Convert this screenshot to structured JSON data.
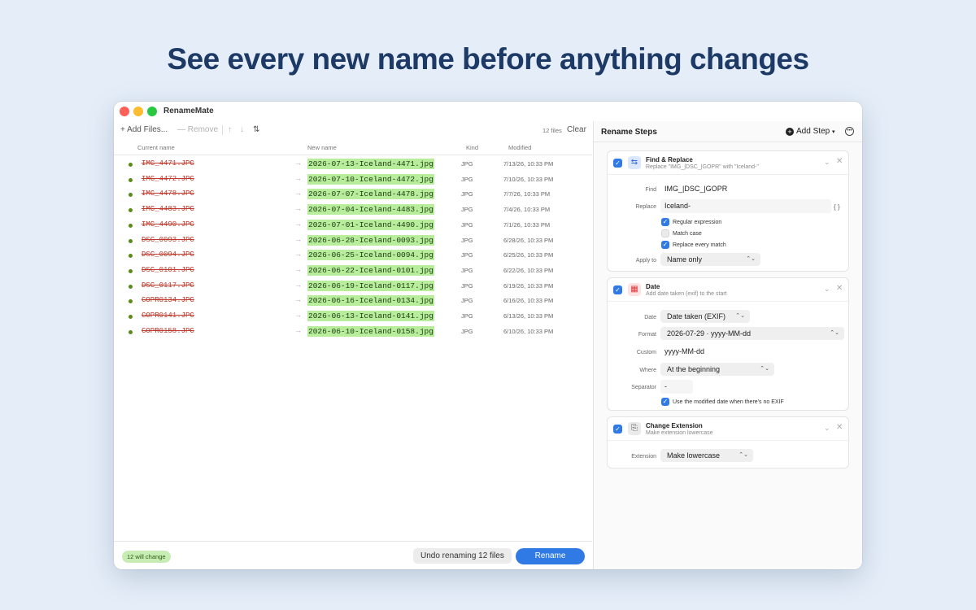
{
  "headline": "See every new name before anything changes",
  "window": {
    "title": "RenameMate"
  },
  "toolbar": {
    "add_files": "Add Files...",
    "remove": "Remove",
    "file_count": "12 files",
    "clear": "Clear"
  },
  "columns": {
    "current": "Current name",
    "new": "New name",
    "kind": "Kind",
    "modified": "Modified"
  },
  "files": [
    {
      "current": "IMG_4471.JPG",
      "new": "2026-07-13-Iceland-4471.jpg",
      "kind": "JPG",
      "modified": "7/13/26, 10:33 PM"
    },
    {
      "current": "IMG_4472.JPG",
      "new": "2026-07-10-Iceland-4472.jpg",
      "kind": "JPG",
      "modified": "7/10/26, 10:33 PM"
    },
    {
      "current": "IMG_4478.JPG",
      "new": "2026-07-07-Iceland-4478.jpg",
      "kind": "JPG",
      "modified": "7/7/26, 10:33 PM"
    },
    {
      "current": "IMG_4483.JPG",
      "new": "2026-07-04-Iceland-4483.jpg",
      "kind": "JPG",
      "modified": "7/4/26, 10:33 PM"
    },
    {
      "current": "IMG_4490.JPG",
      "new": "2026-07-01-Iceland-4490.jpg",
      "kind": "JPG",
      "modified": "7/1/26, 10:33 PM"
    },
    {
      "current": "DSC_0093.JPG",
      "new": "2026-06-28-Iceland-0093.jpg",
      "kind": "JPG",
      "modified": "6/28/26, 10:33 PM"
    },
    {
      "current": "DSC_0094.JPG",
      "new": "2026-06-25-Iceland-0094.jpg",
      "kind": "JPG",
      "modified": "6/25/26, 10:33 PM"
    },
    {
      "current": "DSC_0101.JPG",
      "new": "2026-06-22-Iceland-0101.jpg",
      "kind": "JPG",
      "modified": "6/22/26, 10:33 PM"
    },
    {
      "current": "DSC_0117.JPG",
      "new": "2026-06-19-Iceland-0117.jpg",
      "kind": "JPG",
      "modified": "6/19/26, 10:33 PM"
    },
    {
      "current": "GOPR0134.JPG",
      "new": "2026-06-16-Iceland-0134.jpg",
      "kind": "JPG",
      "modified": "6/16/26, 10:33 PM"
    },
    {
      "current": "GOPR0141.JPG",
      "new": "2026-06-13-Iceland-0141.jpg",
      "kind": "JPG",
      "modified": "6/13/26, 10:33 PM"
    },
    {
      "current": "GOPR0158.JPG",
      "new": "2026-06-10-Iceland-0158.jpg",
      "kind": "JPG",
      "modified": "6/10/26, 10:33 PM"
    }
  ],
  "footer": {
    "change_badge": "12 will change",
    "undo_label": "Undo renaming 12 files",
    "rename_label": "Rename"
  },
  "steps_panel": {
    "title": "Rename Steps",
    "add_step": "Add Step"
  },
  "find_replace": {
    "title": "Find & Replace",
    "subtitle": "Replace \"IMG_|DSC_|GOPR\" with \"Iceland-\"",
    "find_label": "Find",
    "find_value": "IMG_|DSC_|GOPR",
    "replace_label": "Replace",
    "replace_value": "Iceland-",
    "braces": "{ }",
    "regex_label": "Regular expression",
    "match_case_label": "Match case",
    "every_match_label": "Replace every match",
    "apply_label": "Apply to",
    "apply_value": "Name only",
    "regex_checked": true,
    "match_case_checked": false,
    "every_match_checked": true
  },
  "date_step": {
    "title": "Date",
    "subtitle": "Add date taken (exif) to the start",
    "date_label": "Date",
    "date_value": "Date taken (EXIF)",
    "format_label": "Format",
    "format_value": "2026-07-29 · yyyy-MM-dd",
    "custom_label": "Custom",
    "custom_value": "yyyy-MM-dd",
    "where_label": "Where",
    "where_value": "At the beginning",
    "separator_label": "Separator",
    "separator_value": "-",
    "fallback_label": "Use the modified date when there's no EXIF",
    "fallback_checked": true
  },
  "ext_step": {
    "title": "Change Extension",
    "subtitle": "Make extension lowercase",
    "ext_label": "Extension",
    "ext_value": "Make lowercase"
  },
  "colors": {
    "accent": "#2f7ae5",
    "new_name_bg": "#b8ed9c",
    "old_name": "#c0392b",
    "headline": "#1d3a66"
  }
}
